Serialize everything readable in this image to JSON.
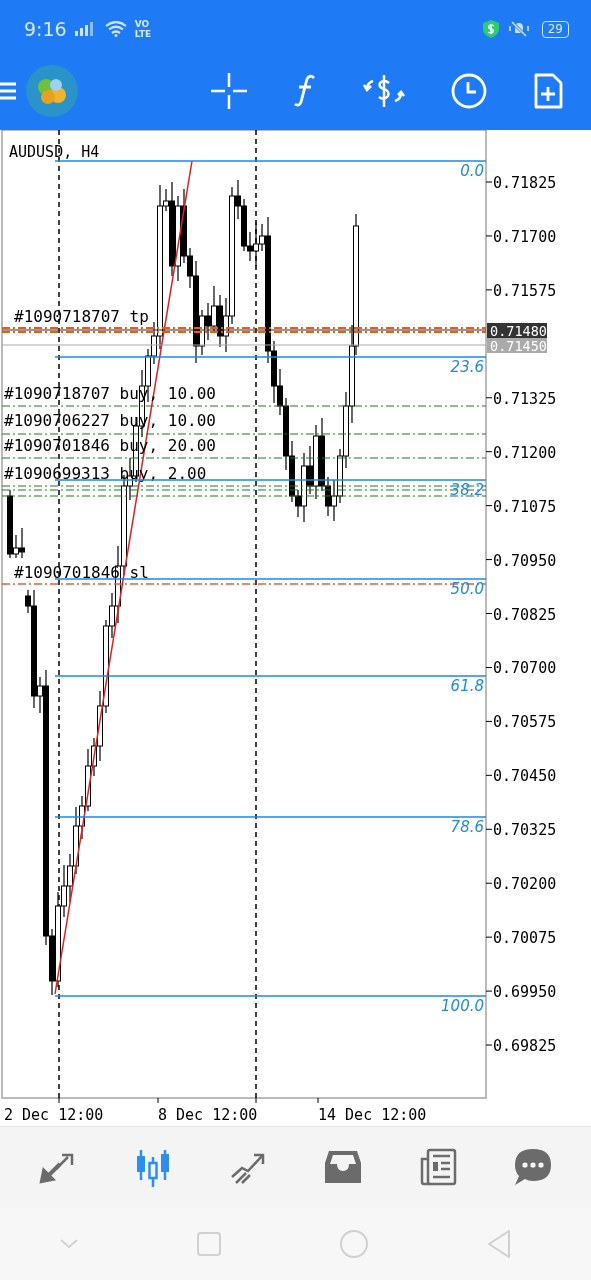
{
  "status_bar": {
    "time": "9:16",
    "network": [
      "VO",
      "LTE"
    ],
    "battery": "29"
  },
  "chart": {
    "symbol": "AUDUSD, H4",
    "price_axis": [
      "0.71825",
      "0.71700",
      "0.71575",
      "0.71325",
      "0.71200",
      "0.71075",
      "0.70950",
      "0.70825",
      "0.70700",
      "0.70575",
      "0.70450",
      "0.70325",
      "0.70200",
      "0.70075",
      "0.69950",
      "0.69825"
    ],
    "price_tags": [
      {
        "text": "0.71480",
        "kind": "bid"
      },
      {
        "text": "0.71450",
        "kind": "ask"
      }
    ],
    "fib_levels": [
      "0.0",
      "23.6",
      "38.2",
      "50.0",
      "61.8",
      "78.6",
      "100.0"
    ],
    "orders": [
      {
        "label": "#1090718707 tp",
        "kind": "tp"
      },
      {
        "label": "#1090718707 buy, 10.00",
        "kind": "buy"
      },
      {
        "label": "#1090706227 buy, 10.00",
        "kind": "buy"
      },
      {
        "label": "#1090701846 buy, 20.00",
        "kind": "buy"
      },
      {
        "label": "#1090699313 buy, 2.00",
        "kind": "buy"
      },
      {
        "label": "#1090701846 sl",
        "kind": "sl"
      }
    ],
    "time_axis": [
      "2 Dec 12:00",
      "8 Dec 12:00",
      "14 Dec 12:00"
    ]
  },
  "bottom_nav": [
    {
      "selected": false
    },
    {
      "selected": true
    },
    {
      "selected": false
    },
    {
      "selected": false
    },
    {
      "selected": false
    },
    {
      "selected": false
    }
  ]
}
